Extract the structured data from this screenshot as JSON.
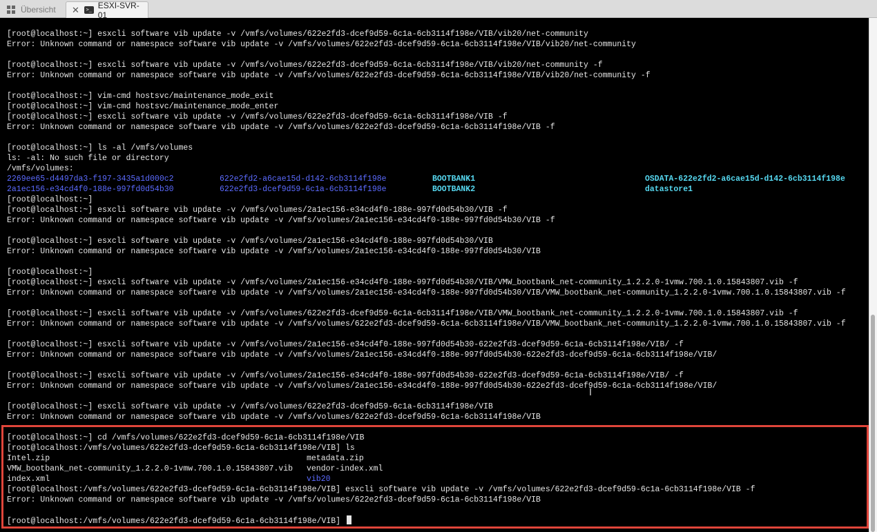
{
  "tabs": {
    "overview": "Übersicht",
    "active": "ESXI-SVR-01"
  },
  "terminal": {
    "lines": [
      "[root@localhost:~] esxcli software vib update -v /vmfs/volumes/622e2fd3-dcef9d59-6c1a-6cb3114f198e/VIB/vib20/net-community",
      "Error: Unknown command or namespace software vib update -v /vmfs/volumes/622e2fd3-dcef9d59-6c1a-6cb3114f198e/VIB/vib20/net-community",
      "",
      "[root@localhost:~] esxcli software vib update -v /vmfs/volumes/622e2fd3-dcef9d59-6c1a-6cb3114f198e/VIB/vib20/net-community -f",
      "Error: Unknown command or namespace software vib update -v /vmfs/volumes/622e2fd3-dcef9d59-6c1a-6cb3114f198e/VIB/vib20/net-community -f",
      "",
      "[root@localhost:~] vim-cmd hostsvc/maintenance_mode_exit",
      "[root@localhost:~] vim-cmd hostsvc/maintenance_mode_enter",
      "[root@localhost:~] esxcli software vib update -v /vmfs/volumes/622e2fd3-dcef9d59-6c1a-6cb3114f198e/VIB -f",
      "Error: Unknown command or namespace software vib update -v /vmfs/volumes/622e2fd3-dcef9d59-6c1a-6cb3114f198e/VIB -f",
      "",
      "[root@localhost:~] ls -al /vmfs/volumes",
      "ls: -al: No such file or directory",
      "/vmfs/volumes:"
    ],
    "listing1": [
      [
        "2269ee65-d4497da3-f197-3435a1d000c2",
        "622e2fd2-a6cae15d-d142-6cb3114f198e",
        "BOOTBANK1",
        "OSDATA-622e2fd2-a6cae15d-d142-6cb3114f198e"
      ],
      [
        "2a1ec156-e34cd4f0-188e-997fd0d54b30",
        "622e2fd3-dcef9d59-6c1a-6cb3114f198e",
        "BOOTBANK2",
        "datastore1"
      ]
    ],
    "lines2": [
      "[root@localhost:~]",
      "[root@localhost:~] esxcli software vib update -v /vmfs/volumes/2a1ec156-e34cd4f0-188e-997fd0d54b30/VIB -f",
      "Error: Unknown command or namespace software vib update -v /vmfs/volumes/2a1ec156-e34cd4f0-188e-997fd0d54b30/VIB -f",
      "",
      "[root@localhost:~] esxcli software vib update -v /vmfs/volumes/2a1ec156-e34cd4f0-188e-997fd0d54b30/VIB",
      "Error: Unknown command or namespace software vib update -v /vmfs/volumes/2a1ec156-e34cd4f0-188e-997fd0d54b30/VIB",
      "",
      "[root@localhost:~]",
      "[root@localhost:~] esxcli software vib update -v /vmfs/volumes/2a1ec156-e34cd4f0-188e-997fd0d54b30/VIB/VMW_bootbank_net-community_1.2.2.0-1vmw.700.1.0.15843807.vib -f",
      "Error: Unknown command or namespace software vib update -v /vmfs/volumes/2a1ec156-e34cd4f0-188e-997fd0d54b30/VIB/VMW_bootbank_net-community_1.2.2.0-1vmw.700.1.0.15843807.vib -f",
      "",
      "[root@localhost:~] esxcli software vib update -v /vmfs/volumes/622e2fd3-dcef9d59-6c1a-6cb3114f198e/VIB/VMW_bootbank_net-community_1.2.2.0-1vmw.700.1.0.15843807.vib -f",
      "Error: Unknown command or namespace software vib update -v /vmfs/volumes/622e2fd3-dcef9d59-6c1a-6cb3114f198e/VIB/VMW_bootbank_net-community_1.2.2.0-1vmw.700.1.0.15843807.vib -f",
      "",
      "[root@localhost:~] esxcli software vib update -v /vmfs/volumes/2a1ec156-e34cd4f0-188e-997fd0d54b30-622e2fd3-dcef9d59-6c1a-6cb3114f198e/VIB/ -f",
      "Error: Unknown command or namespace software vib update -v /vmfs/volumes/2a1ec156-e34cd4f0-188e-997fd0d54b30-622e2fd3-dcef9d59-6c1a-6cb3114f198e/VIB/",
      "",
      "[root@localhost:~] esxcli software vib update -v /vmfs/volumes/2a1ec156-e34cd4f0-188e-997fd0d54b30-622e2fd3-dcef9d59-6c1a-6cb3114f198e/VIB/ -f",
      "Error: Unknown command or namespace software vib update -v /vmfs/volumes/2a1ec156-e34cd4f0-188e-997fd0d54b30-622e2fd3-dcef9d59-6c1a-6cb3114f198e/VIB/",
      "",
      "[root@localhost:~] esxcli software vib update -v /vmfs/volumes/622e2fd3-dcef9d59-6c1a-6cb3114f198e/VIB",
      "Error: Unknown command or namespace software vib update -v /vmfs/volumes/622e2fd3-dcef9d59-6c1a-6cb3114f198e/VIB",
      "",
      "[root@localhost:~] cd /vmfs/volumes/622e2fd3-dcef9d59-6c1a-6cb3114f198e/VIB",
      "[root@localhost:/vmfs/volumes/622e2fd3-dcef9d59-6c1a-6cb3114f198e/VIB] ls"
    ],
    "listing2": [
      [
        "Intel.zip",
        "metadata.zip"
      ],
      [
        "VMW_bootbank_net-community_1.2.2.0-1vmw.700.1.0.15843807.vib",
        "vendor-index.xml"
      ],
      [
        "index.xml",
        "vib20"
      ]
    ],
    "lines3": [
      "[root@localhost:/vmfs/volumes/622e2fd3-dcef9d59-6c1a-6cb3114f198e/VIB] esxcli software vib update -v /vmfs/volumes/622e2fd3-dcef9d59-6c1a-6cb3114f198e/VIB -f",
      "Error: Unknown command or namespace software vib update -v /vmfs/volumes/622e2fd3-dcef9d59-6c1a-6cb3114f198e/VIB",
      ""
    ],
    "prompt": "[root@localhost:/vmfs/volumes/622e2fd3-dcef9d59-6c1a-6cb3114f198e/VIB] "
  },
  "colors": {
    "directory": "#5c6bff",
    "symlink": "#56d8f0",
    "highlight_border": "#e0453a"
  }
}
